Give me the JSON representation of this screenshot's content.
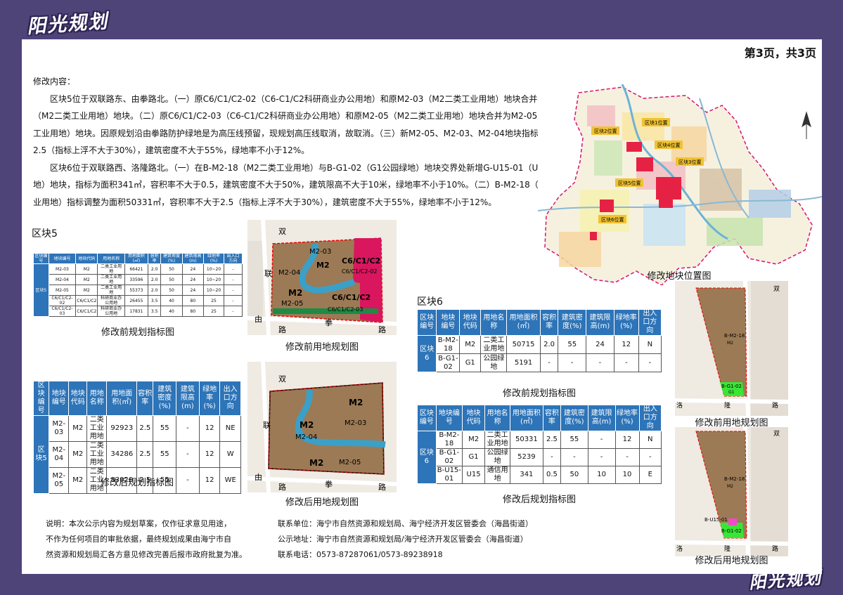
{
  "brand": "阳光规划",
  "page_indicator": "第3页，共3页",
  "intro": {
    "heading": "修改内容：",
    "p1": "区块5位于双联路东、由拳路北。（一）原C6/C1/C2-02（C6-C1/C2科研商业办公用地）和原M2-03（M2二类工业用地）地块合并为M2-03（M2二类工业用地）地块。（二）原C6/C1/C2-03（C6-C1/C2科研商业办公用地）和原M2-05（M2二类工业用地）地块合并为M2-05（M2二类工业用地）地块。因原规划沿由拳路防护绿地是为高压线预留，现规划高压线取消，故取消。（三）新M2-05、M2-03、M2-04地块指标为容积率2.5（指标上浮不大于30%），建筑密度不大于55%，绿地率不小于12%。",
    "p2": "区块6位于双联路西、洛隆路北。（一）在B-M2-18（M2二类工业用地）与B-G1-02（G1公园绿地）地块交界处新增G-U15-01（U15通信用地）地块，指标为面积341㎡，容积率不大于0.5，建筑密度不大于50%，建筑限高不大于10米，绿地率不小于10%。（二）B-M2-18（M2二类工业用地）指标调整为面积50331㎡，容积率不大于2.5（指标上浮不大于30%），建筑密度不大于55%，绿地率不小于12%。"
  },
  "block5": {
    "title": "区块5",
    "before_caption": "修改前规划指标图",
    "after_caption": "修改后规划指标图",
    "before_map_caption": "修改前用地规划图",
    "after_map_caption": "修改后用地规划图",
    "before_headers": [
      "区块编号",
      "地块编号",
      "地块代码",
      "用地名称",
      "用地面积(㎡)",
      "容积率",
      "建筑密度(%)",
      "建筑限高(m)",
      "绿地率(%)",
      "出入口方向"
    ],
    "before_block_label": "区块5",
    "before_rows": [
      [
        "M2-03",
        "M2",
        "二类工业用地",
        "66421",
        "2.0",
        "50",
        "24",
        "10~20",
        "-"
      ],
      [
        "M2-04",
        "M2",
        "二类工业用地",
        "33596",
        "2.0",
        "50",
        "24",
        "10~20",
        "-"
      ],
      [
        "M2-05",
        "M2",
        "二类工业用地",
        "55373",
        "2.0",
        "50",
        "24",
        "10~20",
        "-"
      ],
      [
        "C6/C1/C2-02",
        "C6/C1/C2",
        "科研商业办公用地",
        "26455",
        "3.5",
        "40",
        "80",
        "25",
        "-"
      ],
      [
        "C6/C1/C2-03",
        "C6/C1/C2",
        "科研商业办公用地",
        "17831",
        "3.5",
        "40",
        "80",
        "25",
        "-"
      ]
    ],
    "after_headers": [
      "区块编号",
      "地块编号",
      "地块代码",
      "用地名称",
      "用地面积(㎡)",
      "容积率",
      "建筑密度(%)",
      "建筑限高(m)",
      "绿地率(%)",
      "出入口方向"
    ],
    "after_block_label": "区块5",
    "after_rows": [
      [
        "M2-03",
        "M2",
        "二类工业用地",
        "92923",
        "2.5",
        "55",
        "-",
        "12",
        "NE"
      ],
      [
        "M2-04",
        "M2",
        "二类工业用地",
        "34286",
        "2.5",
        "55",
        "-",
        "12",
        "W"
      ],
      [
        "M2-05",
        "M2",
        "二类工业用地",
        "83920",
        "2.5",
        "55",
        "-",
        "12",
        "WE"
      ]
    ],
    "map_before_labels": {
      "road_n": "双",
      "road_w1": "联",
      "road_w2": "由",
      "road_w3": "路",
      "road_s1": "拳",
      "road_s2": "路",
      "m2_03": "M2-03",
      "m2": "M2",
      "c6_a": "C6/C1/C2",
      "c6_a_code": "C6/C1/C2-02",
      "m2_04": "M2-04",
      "m2_big": "M2",
      "m2_05": "M2-05",
      "c6_b": "C6/C1/C2",
      "c6_b_code": "C6/C1/C2-03"
    },
    "map_after_labels": {
      "road_n": "双",
      "road_w1": "联",
      "road_w2": "由",
      "road_w3": "路",
      "road_s1": "拳",
      "road_s2": "路",
      "m2_a": "M2",
      "m2_03": "M2-03",
      "m2_b": "M2",
      "m2_04": "M2-04",
      "m2_c": "M2",
      "m2_05": "M2-05"
    }
  },
  "block6": {
    "title": "区块6",
    "before_caption": "修改前规划指标图",
    "after_caption": "修改后规划指标图",
    "before_map_caption": "修改前用地规划图",
    "after_map_caption": "修改后用地规划图",
    "before_headers": [
      "区块编号",
      "地块编号",
      "地块代码",
      "用地名称",
      "用地面积(㎡)",
      "容积率",
      "建筑密度(%)",
      "建筑限高(m)",
      "绿地率(%)",
      "出入口方向"
    ],
    "before_block_label": "区块6",
    "before_rows": [
      [
        "B-M2-18",
        "M2",
        "二类工业用地",
        "50715",
        "2.0",
        "55",
        "24",
        "12",
        "N"
      ],
      [
        "B-G1-02",
        "G1",
        "公园绿地",
        "5191",
        "-",
        "-",
        "-",
        "-",
        "-"
      ]
    ],
    "after_headers": [
      "区块编号",
      "地块编号",
      "地块代码",
      "用地名称",
      "用地面积(㎡)",
      "容积率",
      "建筑密度(%)",
      "建筑限高(m)",
      "绿地率(%)",
      "出入口方向"
    ],
    "after_block_label": "区块6",
    "after_rows": [
      [
        "B-M2-18",
        "M2",
        "二类工业用地",
        "50331",
        "2.5",
        "55",
        "-",
        "12",
        "N"
      ],
      [
        "B-G1-02",
        "G1",
        "公园绿地",
        "5239",
        "-",
        "-",
        "-",
        "-",
        "-"
      ],
      [
        "B-U15-01",
        "U15",
        "通信用地",
        "341",
        "0.5",
        "50",
        "10",
        "10",
        "E"
      ]
    ],
    "map_before_labels": {
      "road_n": "双",
      "code": "B-M2-18",
      "m2": "M2",
      "g1_code": "B-G1-02",
      "g1": "G1",
      "road_s1": "洛",
      "road_s2": "隆",
      "road_s3": "路"
    },
    "map_after_labels": {
      "road_n": "双",
      "code": "B-M2-18",
      "m2": "M2",
      "u15": "B-U15-01",
      "g1_code": "B-G1-02",
      "road_s1": "洛",
      "road_s2": "隆",
      "road_s3": "路"
    }
  },
  "location_map": {
    "caption": "修改地块位置图",
    "tags": [
      "区块1位置",
      "区块2位置",
      "区块3位置",
      "区块4位置",
      "区块5位置",
      "区块6位置"
    ]
  },
  "notes": {
    "line1": "说明：本次公示内容为规划草案，仅作征求意见用途，",
    "line2": "不作为任何项目的审批依据，最终规划成果由海宁市自",
    "line3": "然资源和规划局汇各方意见修改完善后报市政府批复为准。"
  },
  "contact": {
    "unit": "联系单位：海宁市自然资源和规划局、海宁经济开发区管委会（海昌街道）",
    "address": "公示地址：海宁市自然资源和规划局/海宁经济开发区管委会（海昌街道）",
    "phone": "联系电话：0573-87287061/0573-89238918"
  },
  "colors": {
    "header_blue": "#2d74b8",
    "purple_bg": "#4e4478",
    "industrial": "#9c7a55",
    "commercial": "#d9165e",
    "river": "#3aa0c8",
    "green": "#1e8a45",
    "bright_green": "#39e635"
  }
}
